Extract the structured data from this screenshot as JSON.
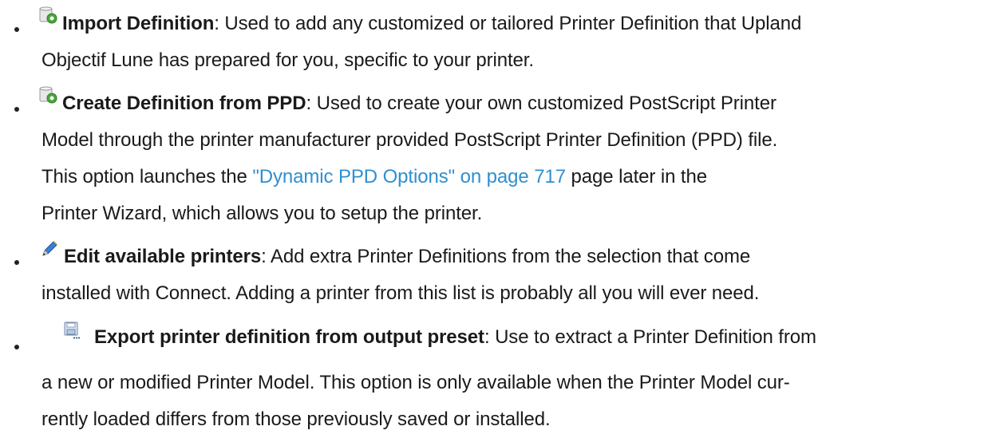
{
  "items": [
    {
      "icon": "printer-definition-add-icon",
      "title": "Import Definition",
      "line1_rest": ": Used to add any customized or tailored Printer Definition that Upland",
      "line2": "Objectif Lune has prepared for you, specific to your printer."
    },
    {
      "icon": "printer-definition-add-icon",
      "title": "Create Definition from PPD",
      "line1_rest": ": Used to create your own customized PostScript Printer",
      "line2": "Model through the printer manufacturer provided PostScript Printer Definition (PPD) file.",
      "line3_pre": "This option launches the ",
      "line3_link": "\"Dynamic PPD Options\" on page 717",
      "line3_post": " page later in the",
      "line4": "Printer Wizard, which allows you to setup the printer."
    },
    {
      "icon": "pencil-icon",
      "title": "Edit available printers",
      "line1_rest": ": Add extra Printer Definitions from the selection that come",
      "line2": "installed with Connect. Adding a printer from this list is probably all you will ever need."
    },
    {
      "icon": "export-save-icon",
      "title": "Export printer definition from output preset",
      "line1_rest": ": Use to extract a Printer Definition from",
      "line2": "a new or modified Printer Model. This option is only available when the Printer Model cur-",
      "line3": "rently loaded differs from those previously saved or installed."
    }
  ],
  "colors": {
    "text": "#1a1a1a",
    "link": "#2f8fd0"
  }
}
